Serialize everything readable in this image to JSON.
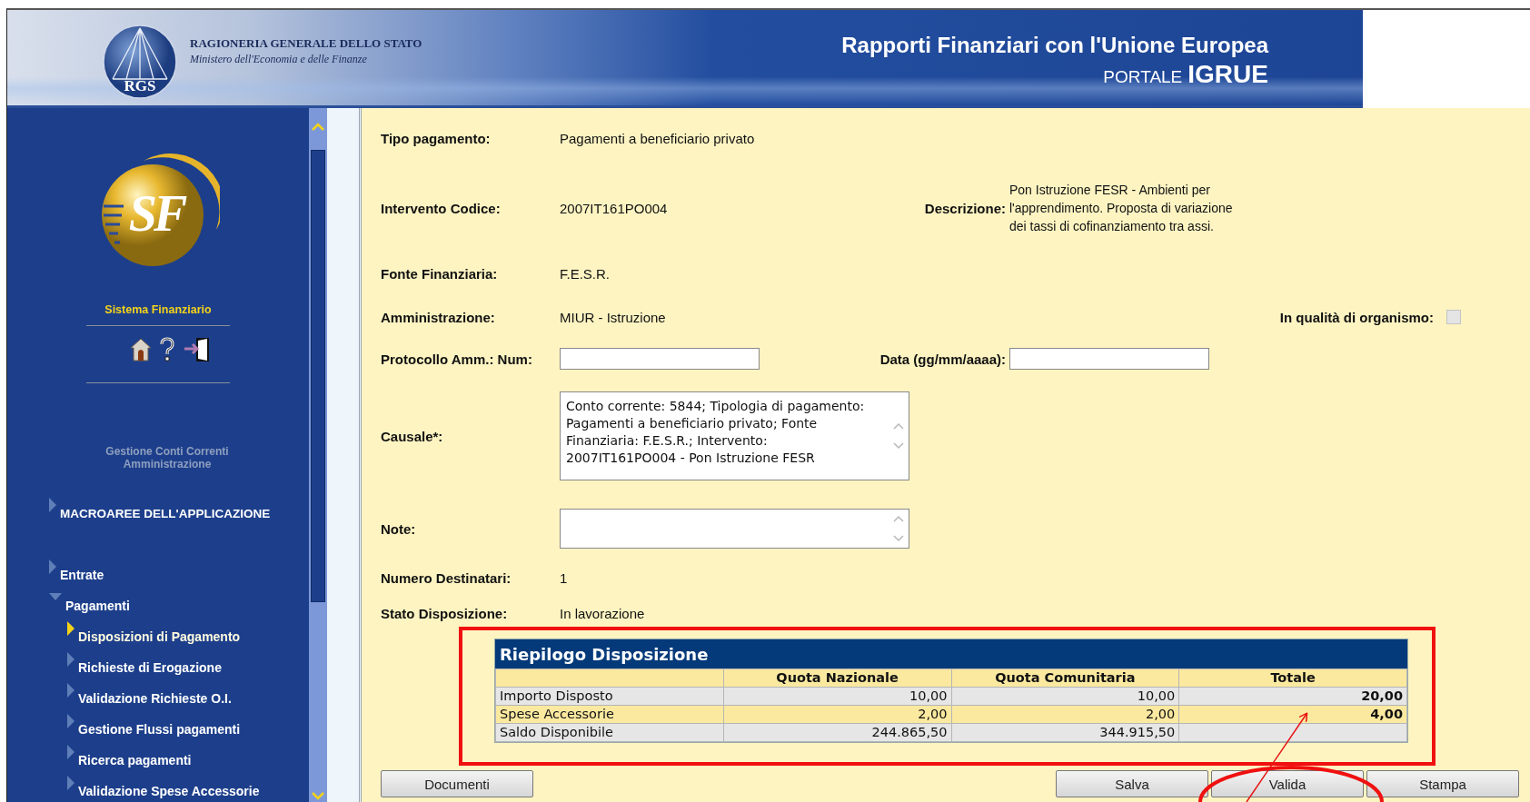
{
  "header": {
    "logo_text": "RGS",
    "org_name": "RAGIONERIA GENERALE DELLO STATO",
    "ministry": "Ministero dell'Economia e delle Finanze",
    "title": "Rapporti Finanziari con l'Unione Europea",
    "portal_prefix": "PORTALE",
    "portal_name": "IGRUE"
  },
  "sidebar": {
    "logo_text": "SF",
    "title": "Sistema Finanziario",
    "subtitle": "Gestione Conti Correnti Amministrazione",
    "menu": [
      {
        "kind": "section",
        "label": "MACROAREE DELL'APPLICAZIONE",
        "expanded": false
      },
      {
        "kind": "group",
        "label": "Entrate",
        "expanded": false
      },
      {
        "kind": "group",
        "label": "Pagamenti",
        "expanded": true,
        "children": [
          {
            "label": "Disposizioni di Pagamento",
            "selected": true
          },
          {
            "label": "Richieste di Erogazione",
            "selected": false
          },
          {
            "label": "Validazione Richieste O.I.",
            "selected": false
          },
          {
            "label": "Gestione Flussi pagamenti",
            "selected": false
          },
          {
            "label": "Ricerca pagamenti",
            "selected": false
          },
          {
            "label": "Validazione Spese Accessorie",
            "selected": false
          }
        ]
      }
    ]
  },
  "form": {
    "rows": [
      {
        "fields": [
          {
            "kind": "text",
            "label": "Tipo pagamento:",
            "value": "Pagamenti a beneficiario privato"
          }
        ]
      },
      {
        "fields": [
          {
            "kind": "text",
            "label": "Intervento Codice:",
            "value": "2007IT161PO004"
          },
          {
            "kind": "note",
            "label": "Descrizione:",
            "value": "Pon Istruzione FESR - Ambienti per l'apprendimento. Proposta di variazione dei tassi di cofinanziamento tra assi."
          }
        ]
      },
      {
        "fields": [
          {
            "kind": "text",
            "label": "Fonte Finanziaria:",
            "value": "F.E.S.R."
          }
        ]
      },
      {
        "fields": [
          {
            "kind": "text",
            "label": "Amministrazione:",
            "value": "MIUR - Istruzione"
          },
          {
            "kind": "checkbox",
            "label": "In qualità di organismo:",
            "checked": false,
            "disabled": true
          }
        ]
      },
      {
        "fields": [
          {
            "kind": "input",
            "label": "Protocollo Amm.: Num:"
          },
          {
            "kind": "input",
            "label": "Data (gg/mm/aaaa):"
          }
        ]
      },
      {
        "fields": [
          {
            "kind": "textarea",
            "label": "Causale*:",
            "value": "Conto corrente: 5844; Tipologia di pagamento: Pagamenti a beneficiario privato; Fonte Finanziaria: F.E.S.R.; Intervento: 2007IT161PO004 - Pon Istruzione FESR"
          }
        ]
      },
      {
        "fields": [
          {
            "kind": "textarea",
            "label": "Note:"
          }
        ]
      },
      {
        "fields": [
          {
            "kind": "text",
            "label": "Numero Destinatari:",
            "value": "1"
          }
        ]
      },
      {
        "fields": [
          {
            "kind": "text",
            "label": "Stato Disposizione:",
            "value": "In lavorazione"
          }
        ]
      }
    ]
  },
  "summary": {
    "title": "Riepilogo Disposizione",
    "columns": [
      "Quota Nazionale",
      "Quota Comunitaria",
      "Totale"
    ],
    "rows": [
      {
        "label": "Importo Disposto",
        "cells": [
          "10,00",
          "10,00",
          "20,00"
        ]
      },
      {
        "label": "Spese Accessorie",
        "cells": [
          "2,00",
          "2,00",
          "4,00"
        ]
      },
      {
        "label": "Saldo Disponibile",
        "cells": [
          "244.865,50",
          "344.915,50"
        ]
      }
    ]
  },
  "actions": {
    "left": [
      "Documenti"
    ],
    "right": [
      "Salva",
      "Valida",
      "Stampa"
    ]
  },
  "annotations": [
    {
      "kind": "rectangle"
    },
    {
      "kind": "ellipse"
    },
    {
      "kind": "arrow"
    }
  ]
}
